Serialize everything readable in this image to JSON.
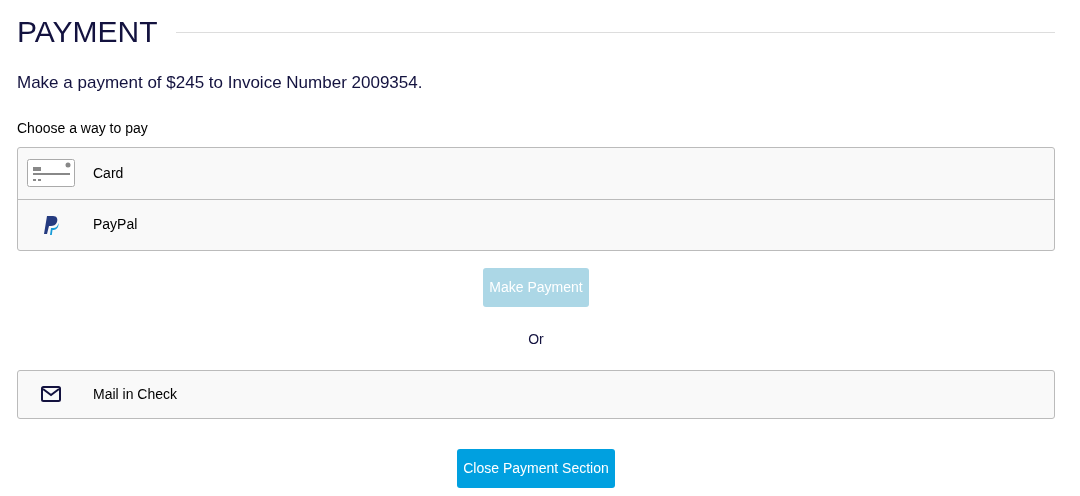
{
  "title": "PAYMENT",
  "summary": "Make a payment of $245 to Invoice Number 2009354.",
  "prompt": "Choose a way to pay",
  "payment_options": [
    {
      "kind": "card",
      "label": "Card"
    },
    {
      "kind": "paypal",
      "label": "PayPal"
    }
  ],
  "make_payment_button": {
    "label": "Make Payment",
    "disabled": true
  },
  "separator": "Or",
  "mail_option": {
    "kind": "mail",
    "label": "Mail in Check"
  },
  "close_button": {
    "label": "Close Payment Section",
    "disabled": false
  }
}
